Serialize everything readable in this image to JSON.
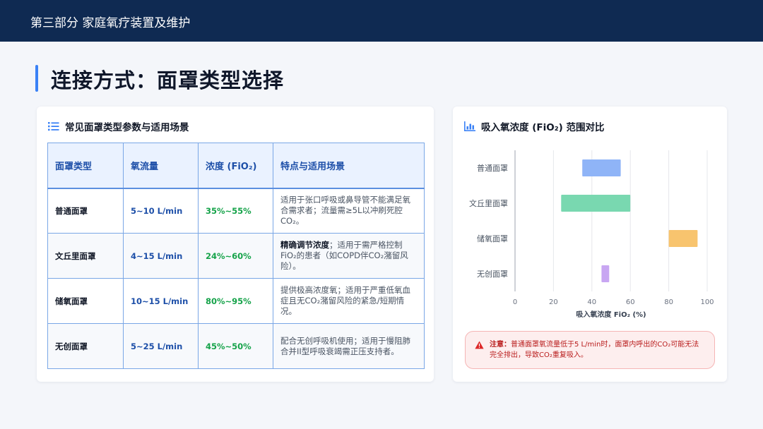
{
  "header": {
    "section_title": "第三部分 家庭氧疗装置及维护"
  },
  "page": {
    "title": "连接方式：面罩类型选择"
  },
  "table_card": {
    "title": "常见面罩类型参数与适用场景",
    "columns": [
      "面罩类型",
      "氧流量",
      "浓度 (FiO₂)",
      "特点与适用场景"
    ],
    "rows": [
      {
        "type": "普通面罩",
        "flow": "5~10 L/min",
        "conc": "35%~55%",
        "desc_bold": "",
        "desc": "适用于张口呼吸或鼻导管不能满足氧合需求者；流量需≥5L以冲刷死腔CO₂。"
      },
      {
        "type": "文丘里面罩",
        "flow": "4~15 L/min",
        "conc": "24%~60%",
        "desc_bold": "精确调节浓度",
        "desc": "；适用于需严格控制FiO₂的患者（如COPD伴CO₂潴留风险）。"
      },
      {
        "type": "储氧面罩",
        "flow": "10~15 L/min",
        "conc": "80%~95%",
        "desc_bold": "",
        "desc": "提供极高浓度氧；适用于严重低氧血症且无CO₂潴留风险的紧急/短期情况。"
      },
      {
        "type": "无创面罩",
        "flow": "5~25 L/min",
        "conc": "45%~50%",
        "desc_bold": "",
        "desc": "配合无创呼吸机使用；适用于慢阻肺合并II型呼吸衰竭需正压支持者。"
      }
    ]
  },
  "chart_card": {
    "title": "吸入氧浓度 (FiO₂) 范围对比"
  },
  "chart_data": {
    "type": "bar",
    "orientation": "horizontal",
    "categories": [
      "普通面罩",
      "文丘里面罩",
      "储氧面罩",
      "无创面罩"
    ],
    "ranges": [
      [
        35,
        55
      ],
      [
        24,
        60
      ],
      [
        80,
        95
      ],
      [
        45,
        49
      ]
    ],
    "colors": [
      "#8fb4f7",
      "#79d8b0",
      "#f8c46e",
      "#c8a6f2"
    ],
    "xlabel": "吸入氧浓度 FiO₂ (%)",
    "xlim": [
      0,
      100
    ],
    "xticks": [
      0,
      20,
      40,
      60,
      80,
      100
    ],
    "grid": true
  },
  "warning": {
    "label": "注意：",
    "text": "普通面罩氧流量低于5 L/min时，面罩内呼出的CO₂可能无法完全排出，导致CO₂重复吸入。"
  }
}
